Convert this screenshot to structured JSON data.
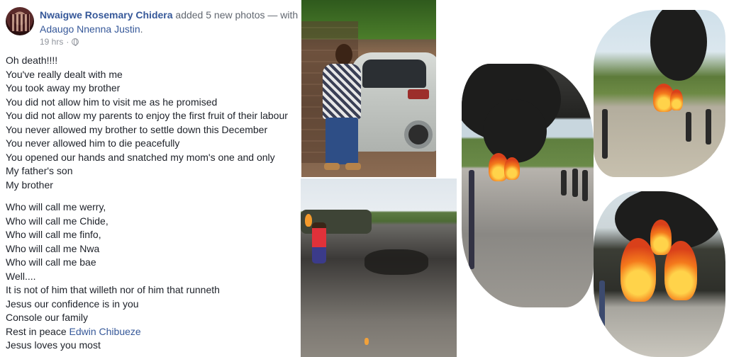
{
  "post": {
    "author": "Nwaigwe Rosemary Chidera",
    "action": "added 5 new photos",
    "with_text": "— with",
    "tagged": "Adaugo Nnenna Justin",
    "tagged_suffix": ".",
    "time": "19 hrs",
    "separator": "·",
    "audience_icon": "globe-icon",
    "lines_part1": [
      "Oh death!!!!",
      "You've really dealt with me",
      "You took away my brother",
      "You did not allow him to visit me as he promised",
      "You did not allow my parents to enjoy the first fruit of their labour",
      "You never allowed my brother to settle down this December",
      "You never allowed him to die peacefully",
      "You opened our hands and snatched my mom's one and only",
      "My father's son",
      "My brother"
    ],
    "lines_part2": [
      "Who will call me werry,",
      "Who will call me Chide,",
      "Who will call me finfo,",
      "Who will call me Nwa",
      "Who will call me bae",
      "Well....",
      "It is not of him that willeth nor of him that runneth",
      "Jesus our confidence is in you",
      "Console our family"
    ],
    "rip_prefix": "Rest in peace",
    "rip_mention": "Edwin Chibueze",
    "closing": "Jesus loves you most"
  },
  "colors": {
    "link": "#365899",
    "text": "#1d2129",
    "meta": "#90949c"
  }
}
